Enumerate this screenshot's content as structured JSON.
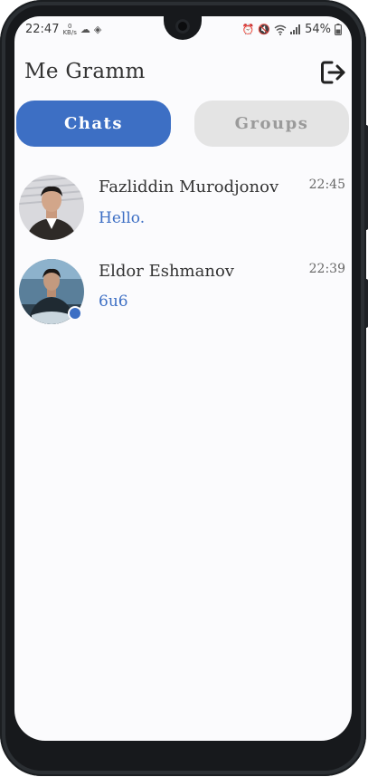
{
  "status_bar": {
    "time": "22:47",
    "net_speed_value": "0",
    "net_speed_unit": "KB/s",
    "battery": "54%",
    "icons": [
      "cloud-icon",
      "diamond-icon",
      "alarm-icon",
      "mute-icon",
      "wifi-icon",
      "signal-icon",
      "battery-icon"
    ]
  },
  "header": {
    "title": "Me Gramm",
    "logout_icon": "logout-icon"
  },
  "tabs": [
    {
      "label": "Chats",
      "active": true
    },
    {
      "label": "Groups",
      "active": false
    }
  ],
  "chats": [
    {
      "name": "Fazliddin Murodjonov",
      "time": "22:45",
      "preview": "Hello.",
      "online": false
    },
    {
      "name": "Eldor Eshmanov",
      "time": "22:39",
      "preview": "6u6",
      "online": true
    }
  ],
  "colors": {
    "accent": "#3d6fc4",
    "inactive_tab": "#e4e4e4",
    "inactive_tab_text": "#9a9a9a",
    "background": "#fbfbfd"
  }
}
